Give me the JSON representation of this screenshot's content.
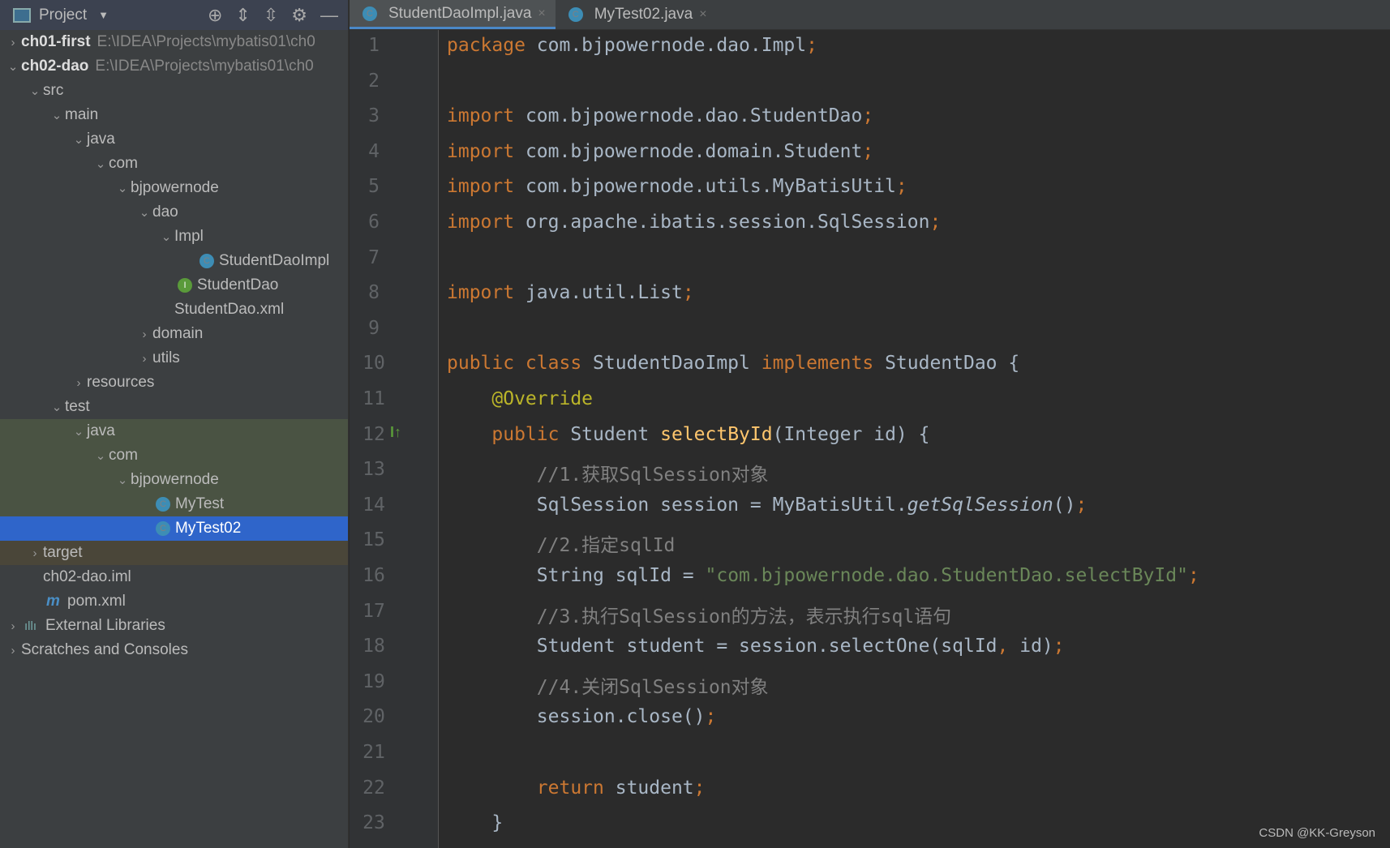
{
  "sidebar": {
    "title": "Project",
    "tools": [
      "⊕",
      "⇕",
      "⇳",
      "⚙",
      "—"
    ],
    "items": [
      {
        "label": "ch01-first",
        "path": "E:\\IDEA\\Projects\\mybatis01\\ch0",
        "indent": 0,
        "arrow": "›",
        "icon": "module",
        "bold": true
      },
      {
        "label": "ch02-dao",
        "path": "E:\\IDEA\\Projects\\mybatis01\\ch0",
        "indent": 0,
        "arrow": "⌄",
        "icon": "module",
        "bold": true
      },
      {
        "label": "src",
        "indent": 1,
        "arrow": "⌄",
        "icon": "folder"
      },
      {
        "label": "main",
        "indent": 2,
        "arrow": "⌄",
        "icon": "folder"
      },
      {
        "label": "java",
        "indent": 3,
        "arrow": "⌄",
        "icon": "folder-blue"
      },
      {
        "label": "com",
        "indent": 4,
        "arrow": "⌄",
        "icon": "package"
      },
      {
        "label": "bjpowernode",
        "indent": 5,
        "arrow": "⌄",
        "icon": "package"
      },
      {
        "label": "dao",
        "indent": 6,
        "arrow": "⌄",
        "icon": "package"
      },
      {
        "label": "Impl",
        "indent": 7,
        "arrow": "⌄",
        "icon": "package"
      },
      {
        "label": "StudentDaoImpl",
        "indent": 8,
        "arrow": "",
        "icon": "class"
      },
      {
        "label": "StudentDao",
        "indent": 7,
        "arrow": "",
        "icon": "interface"
      },
      {
        "label": "StudentDao.xml",
        "indent": 7,
        "arrow": "",
        "icon": "xml"
      },
      {
        "label": "domain",
        "indent": 6,
        "arrow": "›",
        "icon": "package"
      },
      {
        "label": "utils",
        "indent": 6,
        "arrow": "›",
        "icon": "package"
      },
      {
        "label": "resources",
        "indent": 3,
        "arrow": "›",
        "icon": "folder"
      },
      {
        "label": "test",
        "indent": 2,
        "arrow": "⌄",
        "icon": "folder"
      },
      {
        "label": "java",
        "indent": 3,
        "arrow": "⌄",
        "icon": "folder-green",
        "state": "hl"
      },
      {
        "label": "com",
        "indent": 4,
        "arrow": "⌄",
        "icon": "package",
        "state": "hl"
      },
      {
        "label": "bjpowernode",
        "indent": 5,
        "arrow": "⌄",
        "icon": "package",
        "state": "hl"
      },
      {
        "label": "MyTest",
        "indent": 6,
        "arrow": "",
        "icon": "class",
        "state": "hl"
      },
      {
        "label": "MyTest02",
        "indent": 6,
        "arrow": "",
        "icon": "class",
        "state": "sel"
      },
      {
        "label": "target",
        "indent": 1,
        "arrow": "›",
        "icon": "folder-orange",
        "state": "tg"
      },
      {
        "label": "ch02-dao.iml",
        "indent": 1,
        "arrow": "",
        "icon": "iml"
      },
      {
        "label": "pom.xml",
        "indent": 1,
        "arrow": "",
        "icon": "maven"
      },
      {
        "label": "External Libraries",
        "indent": 0,
        "arrow": "›",
        "icon": "libraries"
      },
      {
        "label": "Scratches and Consoles",
        "indent": 0,
        "arrow": "›",
        "icon": "scratches"
      }
    ]
  },
  "tabs": [
    {
      "label": "StudentDaoImpl.java",
      "active": true
    },
    {
      "label": "MyTest02.java",
      "active": false
    }
  ],
  "code": [
    [
      [
        "package ",
        "k"
      ],
      [
        "com.bjpowernode.dao.Impl",
        ""
      ],
      [
        ";",
        "k"
      ]
    ],
    [],
    [
      [
        "import ",
        "k"
      ],
      [
        "com.bjpowernode.dao.StudentDao",
        ""
      ],
      [
        ";",
        "k"
      ]
    ],
    [
      [
        "import ",
        "k"
      ],
      [
        "com.bjpowernode.domain.Student",
        ""
      ],
      [
        ";",
        "k"
      ]
    ],
    [
      [
        "import ",
        "k"
      ],
      [
        "com.bjpowernode.utils.MyBatisUtil",
        ""
      ],
      [
        ";",
        "k"
      ]
    ],
    [
      [
        "import ",
        "k"
      ],
      [
        "org.apache.ibatis.session.SqlSession",
        ""
      ],
      [
        ";",
        "k"
      ]
    ],
    [],
    [
      [
        "import ",
        "k"
      ],
      [
        "java.util.List",
        ""
      ],
      [
        ";",
        "k"
      ]
    ],
    [],
    [
      [
        "public class ",
        "k"
      ],
      [
        "StudentDaoImpl ",
        ""
      ],
      [
        "implements ",
        "k"
      ],
      [
        "StudentDao {",
        ""
      ]
    ],
    [
      [
        "    ",
        ""
      ],
      [
        "@Override",
        "a"
      ]
    ],
    [
      [
        "    ",
        ""
      ],
      [
        "public ",
        "k"
      ],
      [
        "Student ",
        ""
      ],
      [
        "selectById",
        "m"
      ],
      [
        "(Integer id) {",
        ""
      ]
    ],
    [
      [
        "        ",
        ""
      ],
      [
        "//1.获取SqlSession对象",
        "c"
      ]
    ],
    [
      [
        "        SqlSession session = MyBatisUtil.",
        ""
      ],
      [
        "getSqlSession",
        "it"
      ],
      [
        "()",
        ""
      ],
      [
        ";",
        "k"
      ]
    ],
    [
      [
        "        ",
        ""
      ],
      [
        "//2.指定sqlId",
        "c"
      ]
    ],
    [
      [
        "        String sqlId = ",
        ""
      ],
      [
        "\"com.bjpowernode.dao.StudentDao.selectById\"",
        "s"
      ],
      [
        ";",
        "k"
      ]
    ],
    [
      [
        "        ",
        ""
      ],
      [
        "//3.执行SqlSession的方法，表示执行sql语句",
        "c"
      ]
    ],
    [
      [
        "        Student student = session.selectOne(sqlId",
        ""
      ],
      [
        ", ",
        "k"
      ],
      [
        "id)",
        ""
      ],
      [
        ";",
        "k"
      ]
    ],
    [
      [
        "        ",
        ""
      ],
      [
        "//4.关闭SqlSession对象",
        "c"
      ]
    ],
    [
      [
        "        session.close()",
        ""
      ],
      [
        ";",
        "k"
      ]
    ],
    [],
    [
      [
        "        ",
        ""
      ],
      [
        "return ",
        "k"
      ],
      [
        "student",
        ""
      ],
      [
        ";",
        "k"
      ]
    ],
    [
      [
        "    }",
        ""
      ]
    ]
  ],
  "watermark": "CSDN @KK-Greyson"
}
